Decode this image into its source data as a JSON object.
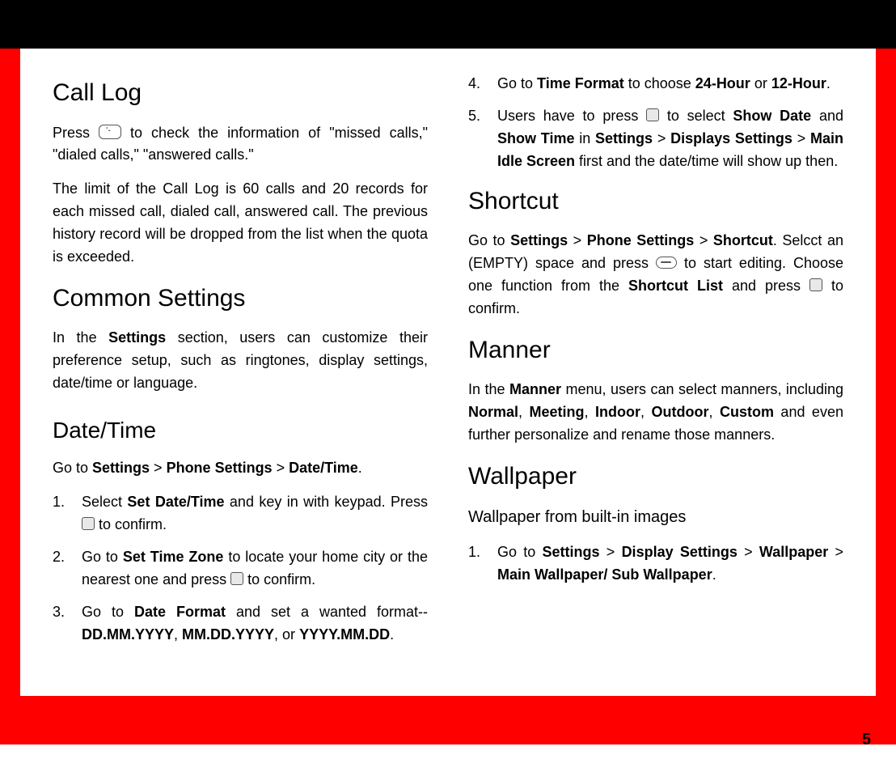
{
  "page_number": "5",
  "left": {
    "call_log": {
      "heading": "Call Log",
      "p1_a": "Press ",
      "p1_b": " to check the information of \"missed calls,\" \"dialed calls,\" \"answered calls.\"",
      "p2": "The limit of the Call Log is 60 calls and 20 records for each missed call, dialed call, answered call. The previous history record will be dropped from the list when the quota is exceeded."
    },
    "common": {
      "heading": "Common Settings",
      "p1_a": "In the ",
      "p1_b": "Settings",
      "p1_c": " section, users can customize their preference setup, such as ringtones,  display settings, date/time or language."
    },
    "datetime": {
      "heading": "Date/Time",
      "intro_a": "Go to ",
      "intro_b": "Settings",
      "intro_c": " > ",
      "intro_d": "Phone Settings",
      "intro_e": " > ",
      "intro_f": "Date/Time",
      "intro_g": ".",
      "li1_num": "1.",
      "li1_a": "Select ",
      "li1_b": "Set Date/Time",
      "li1_c": " and key in with keypad. Press ",
      "li1_d": " to confirm.",
      "li2_num": "2.",
      "li2_a": "Go to ",
      "li2_b": "Set Time Zone",
      "li2_c": " to locate your home city or the nearest one and press ",
      "li2_d": " to confirm.",
      "li3_num": "3.",
      "li3_a": "Go to ",
      "li3_b": "Date Format",
      "li3_c": " and set a wanted format--",
      "li3_d": "DD.MM.YYYY",
      "li3_e": ", ",
      "li3_f": "MM.DD.YYYY",
      "li3_g": ", or ",
      "li3_h": "YYYY.MM.DD",
      "li3_i": "."
    }
  },
  "right": {
    "datetime_cont": {
      "li4_num": "4.",
      "li4_a": "Go to ",
      "li4_b": "Time Format",
      "li4_c": " to choose ",
      "li4_d": "24-Hour",
      "li4_e": " or ",
      "li4_f": "12-Hour",
      "li4_g": ".",
      "li5_num": "5.",
      "li5_a": "Users have to press ",
      "li5_b": " to select ",
      "li5_c": "Show Date",
      "li5_d": " and ",
      "li5_e": "Show Time",
      "li5_f": " in ",
      "li5_g": "Settings",
      "li5_h": " > ",
      "li5_i": "Displays Settings",
      "li5_j": " > ",
      "li5_k": "Main Idle Screen",
      "li5_l": " first and the date/time will show up then."
    },
    "shortcut": {
      "heading": "Shortcut",
      "p_a": "Go to ",
      "p_b": "Settings",
      "p_c": " > ",
      "p_d": "Phone Settings",
      "p_e": " > ",
      "p_f": "Shortcut",
      "p_g": ". Selcct an (EMPTY) space and press ",
      "p_h": " to start editing. Choose one function from the ",
      "p_i": "Shortcut List",
      "p_j": " and press ",
      "p_k": " to confirm."
    },
    "manner": {
      "heading": "Manner",
      "p_a": "In the ",
      "p_b": "Manner",
      "p_c": " menu, users can select manners, including ",
      "p_d": "Normal",
      "p_e": ", ",
      "p_f": "Meeting",
      "p_g": ", ",
      "p_h": "Indoor",
      "p_i": ", ",
      "p_j": "Outdoor",
      "p_k": ", ",
      "p_l": "Custom",
      "p_m": " and even further personalize and rename those manners."
    },
    "wallpaper": {
      "heading": "Wallpaper",
      "sub": "Wallpaper from built-in images",
      "li1_num": "1.",
      "li1_a": "Go to ",
      "li1_b": "Settings",
      "li1_c": " > ",
      "li1_d": "Display Settings",
      "li1_e": " > ",
      "li1_f": "Wallpaper",
      "li1_g": " > ",
      "li1_h": "Main Wallpaper/ Sub Wallpaper",
      "li1_i": "."
    }
  }
}
